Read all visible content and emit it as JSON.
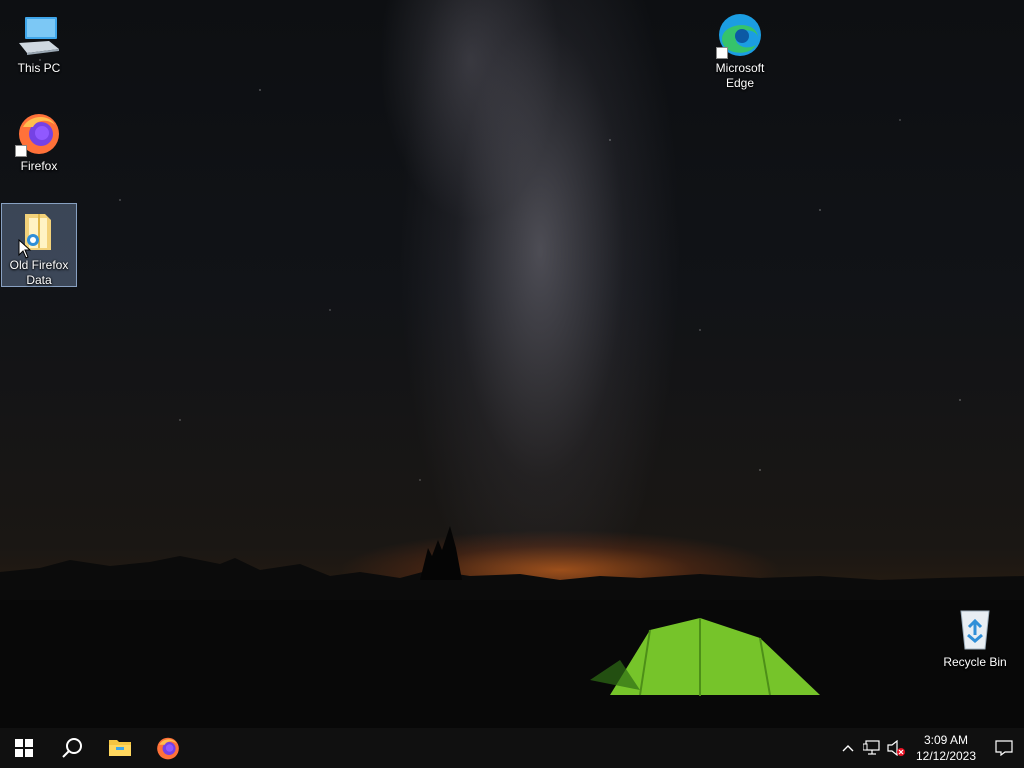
{
  "desktop": {
    "icons": [
      {
        "label": "This PC",
        "icon": "this-pc-icon"
      },
      {
        "label": "Firefox",
        "icon": "firefox-icon"
      },
      {
        "label": "Old Firefox Data",
        "icon": "folder-icon"
      },
      {
        "label": "Microsoft Edge",
        "icon": "edge-icon"
      },
      {
        "label": "Recycle Bin",
        "icon": "recycle-bin-icon"
      }
    ]
  },
  "taskbar": {
    "start": "windows-start-icon",
    "search": "search-icon",
    "pinned": [
      "file-explorer-icon",
      "firefox-icon"
    ],
    "tray": {
      "chevron": "chevron-up-icon",
      "network": "network-icon",
      "volume": "volume-muted-icon",
      "time": "3:09 AM",
      "date": "12/12/2023",
      "notifications": "action-center-icon"
    }
  },
  "colors": {
    "taskbar_bg": "#101010",
    "selection": "#8caad2",
    "tent_green": "#7ccf2c",
    "horizon_orange": "#ff7a1e"
  }
}
